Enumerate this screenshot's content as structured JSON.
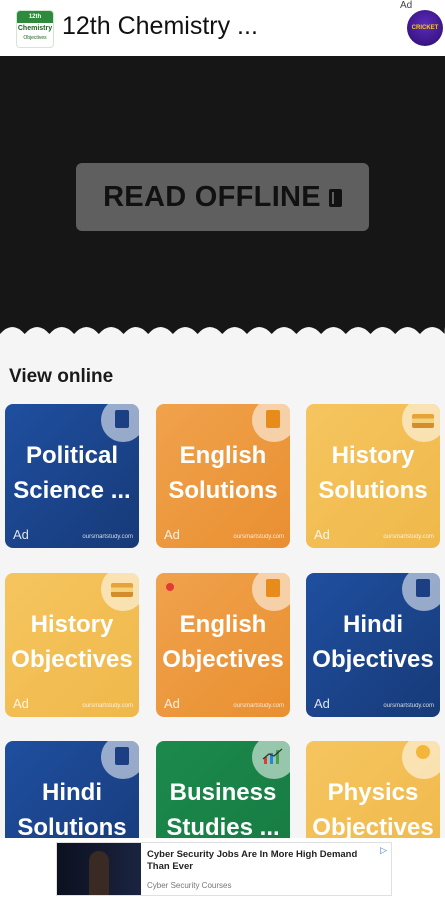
{
  "header": {
    "logo_top": "12th",
    "logo_main": "Chemistry",
    "logo_sub": "Objectives",
    "title": "12th Chemistry ...",
    "ad_label": "Ad",
    "ad_app_text": "CRICKET"
  },
  "banner": {
    "button_label": "READ OFFLINE",
    "icon": "book-icon"
  },
  "section": {
    "title": "View online"
  },
  "cards": [
    {
      "title_line1": "Political",
      "title_line2": "Science ...",
      "ad": "Ad",
      "site": "oursmartstudy.com",
      "color": "#1f4fa0",
      "icon": "book-icon"
    },
    {
      "title_line1": "English",
      "title_line2": "Solutions",
      "ad": "Ad",
      "site": "oursmartstudy.com",
      "color": "#f0a24c",
      "icon": "book-icon"
    },
    {
      "title_line1": "History",
      "title_line2": "Solutions",
      "ad": "Ad",
      "site": "oursmartstudy.com",
      "color": "#f6c55f",
      "icon": "book-stack-icon"
    },
    {
      "title_line1": "History",
      "title_line2": "Objectives",
      "ad": "Ad",
      "site": "oursmartstudy.com",
      "color": "#f6c55f",
      "icon": "book-stack-icon"
    },
    {
      "title_line1": "English",
      "title_line2": "Objectives",
      "ad": "Ad",
      "site": "oursmartstudy.com",
      "color": "#f0a24c",
      "icon": "book-icon"
    },
    {
      "title_line1": "Hindi",
      "title_line2": "Objectives",
      "ad": "Ad",
      "site": "oursmartstudy.com",
      "color": "#1f4fa0",
      "icon": "book-icon"
    },
    {
      "title_line1": "Hindi",
      "title_line2": "Solutions",
      "ad": "",
      "site": "",
      "color": "#1f4fa0",
      "icon": "book-icon"
    },
    {
      "title_line1": "Business",
      "title_line2": "Studies ...",
      "ad": "",
      "site": "",
      "color": "#1c8a4c",
      "icon": "chart-icon"
    },
    {
      "title_line1": "Physics",
      "title_line2": "Objectives",
      "ad": "",
      "site": "",
      "color": "#f6c55f",
      "icon": "bulb-icon"
    }
  ],
  "bottom_ad": {
    "headline": "Cyber Security Jobs Are In More High Demand Than Ever",
    "source": "Cyber Security Courses",
    "choice": "▷"
  }
}
